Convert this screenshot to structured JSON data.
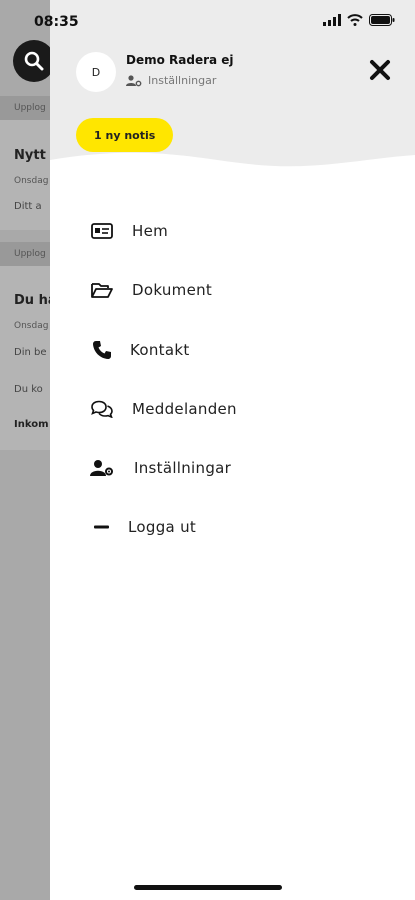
{
  "status_bar": {
    "time": "08:35"
  },
  "background": {
    "band1": "Upplog",
    "item1_title": "Nytt",
    "item1_date": "Onsdag",
    "item1_text": "Ditt a",
    "band2": "Upplog",
    "item2_title": "Du ha",
    "item2_date": "Onsdag",
    "item2_text1": "Din be",
    "item2_text2": "Du ko",
    "item2_bold": "Inkom"
  },
  "drawer": {
    "avatar_initial": "D",
    "user_name": "Demo Radera ej",
    "user_settings_label": "Inställningar",
    "notification_badge": "1 ny notis",
    "menu": [
      {
        "label": "Hem",
        "icon": "id-card-icon"
      },
      {
        "label": "Dokument",
        "icon": "folder-open-icon"
      },
      {
        "label": "Kontakt",
        "icon": "phone-icon"
      },
      {
        "label": "Meddelanden",
        "icon": "chat-bubbles-icon"
      },
      {
        "label": "Inställningar",
        "icon": "user-gear-icon"
      },
      {
        "label": "Logga ut",
        "icon": "minus-icon"
      }
    ]
  },
  "colors": {
    "accent_yellow": "#ffe600",
    "header_gray": "#ececec",
    "overlay_gray": "#a9a9a9"
  }
}
